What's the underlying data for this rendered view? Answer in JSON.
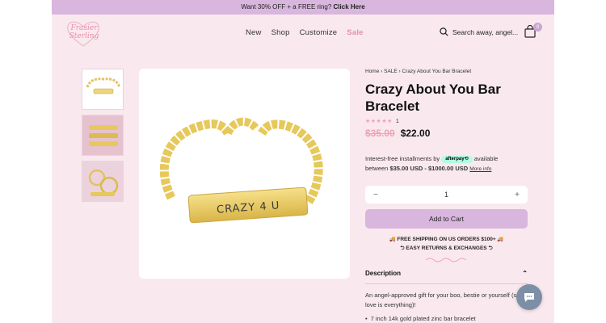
{
  "promo": {
    "text": "Want 30% OFF + a FREE ring?",
    "link": "Click Here"
  },
  "logo": {
    "line1": "Frasier",
    "line2": "Sterling"
  },
  "nav": {
    "items": [
      "New",
      "Shop",
      "Customize"
    ],
    "sale": "Sale"
  },
  "search": {
    "placeholder": "Search away, angel..."
  },
  "cart": {
    "count": "0"
  },
  "product": {
    "breadcrumb": "Home › SALE › Crazy About You Bar Bracelet",
    "title": "Crazy About You Bar Bracelet",
    "stars": "★★★★★",
    "rating_count": "1",
    "old_price": "$35.00",
    "price": "$22.00",
    "engraving": "CRAZY 4 U"
  },
  "installments": {
    "pre": "Interest-free installments by",
    "badge": "afterpay⟲",
    "post": "available",
    "line2_pre": "between",
    "range": "$35.00 USD - $1000.00 USD",
    "more": "More info"
  },
  "quantity": {
    "minus": "−",
    "value": "1",
    "plus": "+"
  },
  "add_to_cart": "Add to Cart",
  "shipping": {
    "line1": "🚚 FREE SHIPPING ON US ORDERS $100+ 🚚",
    "line2": "⮌ EASY RETURNS & EXCHANGES ⮌"
  },
  "description": {
    "heading": "Description",
    "chevron": "⌃",
    "text": "An angel-approved gift for your boo, bestie or yourself (self-love is everything)!",
    "bullet": "7 inch 14k gold plated zinc bar bracelet"
  },
  "colors": {
    "accent": "#d9b6dd",
    "pink": "#f0a0b5",
    "background": "#f9e9ee",
    "gold": "#e7c85a"
  }
}
